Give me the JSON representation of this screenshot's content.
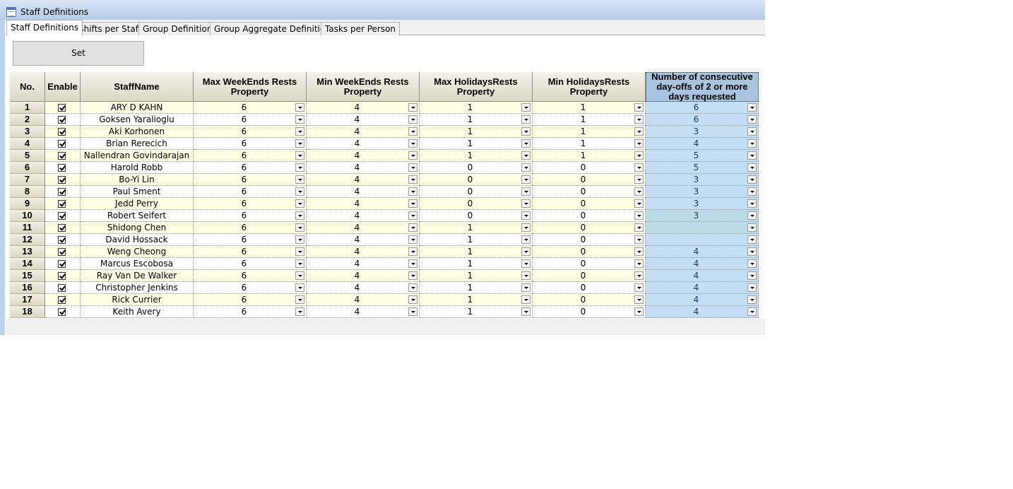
{
  "window": {
    "title": "Staff Definitions"
  },
  "tabs": [
    "Staff Definitions",
    "Shifts per Staff",
    "Group Definitions",
    "Group Aggregate Definitions",
    "Tasks per Person"
  ],
  "set_label": "Set",
  "columns": {
    "no": "No.",
    "enable": "Enable",
    "staff_name": "StaffName",
    "max_weekends": "Max WeekEnds Rests Property",
    "min_weekends": "Min WeekEnds Rests Property",
    "max_holidays": "Max HolidaysRests Property",
    "min_holidays": "Min HolidaysRests Property",
    "consecutive": "Number of consecutive day-offs of 2 or more days requested"
  },
  "rows": [
    {
      "no": "1",
      "enable": true,
      "name": "ARY D KAHN",
      "max_we": "6",
      "min_we": "4",
      "max_hol": "1",
      "min_hol": "1",
      "consec": "6"
    },
    {
      "no": "2",
      "enable": true,
      "name": "Goksen Yaralioglu",
      "max_we": "6",
      "min_we": "4",
      "max_hol": "1",
      "min_hol": "1",
      "consec": "6"
    },
    {
      "no": "3",
      "enable": true,
      "name": "Aki Korhonen",
      "max_we": "6",
      "min_we": "4",
      "max_hol": "1",
      "min_hol": "1",
      "consec": "3"
    },
    {
      "no": "4",
      "enable": true,
      "name": "Brian Rerecich",
      "max_we": "6",
      "min_we": "4",
      "max_hol": "1",
      "min_hol": "1",
      "consec": "4"
    },
    {
      "no": "5",
      "enable": true,
      "name": "Nallendran Govindarajan",
      "max_we": "6",
      "min_we": "4",
      "max_hol": "1",
      "min_hol": "1",
      "consec": "5"
    },
    {
      "no": "6",
      "enable": true,
      "name": "Harold Robb",
      "max_we": "6",
      "min_we": "4",
      "max_hol": "0",
      "min_hol": "0",
      "consec": "5"
    },
    {
      "no": "7",
      "enable": true,
      "name": "Bo-Yi Lin",
      "max_we": "6",
      "min_we": "4",
      "max_hol": "0",
      "min_hol": "0",
      "consec": "3"
    },
    {
      "no": "8",
      "enable": true,
      "name": "Paul Sment",
      "max_we": "6",
      "min_we": "4",
      "max_hol": "0",
      "min_hol": "0",
      "consec": "3"
    },
    {
      "no": "9",
      "enable": true,
      "name": "Jedd Perry",
      "max_we": "6",
      "min_we": "4",
      "max_hol": "0",
      "min_hol": "0",
      "consec": "3"
    },
    {
      "no": "10",
      "enable": true,
      "name": "Robert Seifert",
      "max_we": "6",
      "min_we": "4",
      "max_hol": "0",
      "min_hol": "0",
      "consec": "3"
    },
    {
      "no": "11",
      "enable": true,
      "name": "Shidong Chen",
      "max_we": "6",
      "min_we": "4",
      "max_hol": "1",
      "min_hol": "0",
      "consec": ""
    },
    {
      "no": "12",
      "enable": true,
      "name": "David Hossack",
      "max_we": "6",
      "min_we": "4",
      "max_hol": "1",
      "min_hol": "0",
      "consec": ""
    },
    {
      "no": "13",
      "enable": true,
      "name": "Weng Cheong",
      "max_we": "6",
      "min_we": "4",
      "max_hol": "1",
      "min_hol": "0",
      "consec": "4"
    },
    {
      "no": "14",
      "enable": true,
      "name": "Marcus Escobosa",
      "max_we": "6",
      "min_we": "4",
      "max_hol": "1",
      "min_hol": "0",
      "consec": "4"
    },
    {
      "no": "15",
      "enable": true,
      "name": "Ray Van De Walker",
      "max_we": "6",
      "min_we": "4",
      "max_hol": "1",
      "min_hol": "0",
      "consec": "4"
    },
    {
      "no": "16",
      "enable": true,
      "name": "Christopher Jenkins",
      "max_we": "6",
      "min_we": "4",
      "max_hol": "1",
      "min_hol": "0",
      "consec": "4"
    },
    {
      "no": "17",
      "enable": true,
      "name": "Rick Currier",
      "max_we": "6",
      "min_we": "4",
      "max_hol": "1",
      "min_hol": "0",
      "consec": "4"
    },
    {
      "no": "18",
      "enable": true,
      "name": "Keith Avery",
      "max_we": "6",
      "min_we": "4",
      "max_hol": "1",
      "min_hol": "0",
      "consec": "4"
    }
  ]
}
